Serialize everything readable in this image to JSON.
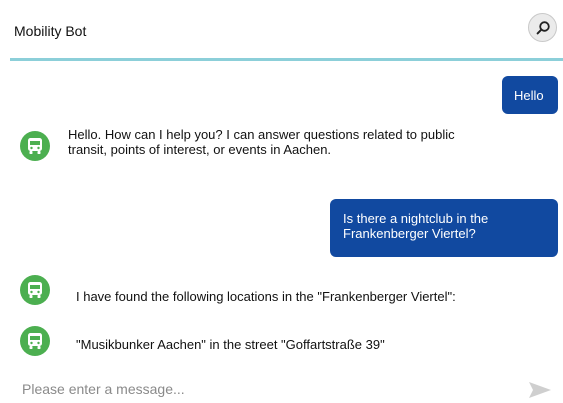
{
  "header": {
    "title": "Mobility Bot",
    "search_icon": "search-icon"
  },
  "colors": {
    "user_bubble": "#1149a0",
    "bot_avatar": "#4caf50",
    "header_divider": "#8ccfd9"
  },
  "messages": [
    {
      "sender": "user",
      "lines": [
        "Hello"
      ]
    },
    {
      "sender": "bot",
      "icon": "bus-icon",
      "lines": [
        "Hello. How can I help you? I can answer questions related to public",
        "transit, points of interest, or events in Aachen."
      ]
    },
    {
      "sender": "user",
      "lines": [
        "Is there a nightclub in the",
        "Frankenberger Viertel?"
      ]
    },
    {
      "sender": "bot",
      "icon": "bus-icon",
      "lines": [
        "I have found the following locations in the \"Frankenberger Viertel\":"
      ]
    },
    {
      "sender": "bot",
      "icon": "bus-icon",
      "lines": [
        "\"Musikbunker Aachen\" in the street \"Goffartstraße 39\""
      ]
    }
  ],
  "composer": {
    "placeholder": "Please enter a message...",
    "send_icon": "send-icon"
  }
}
